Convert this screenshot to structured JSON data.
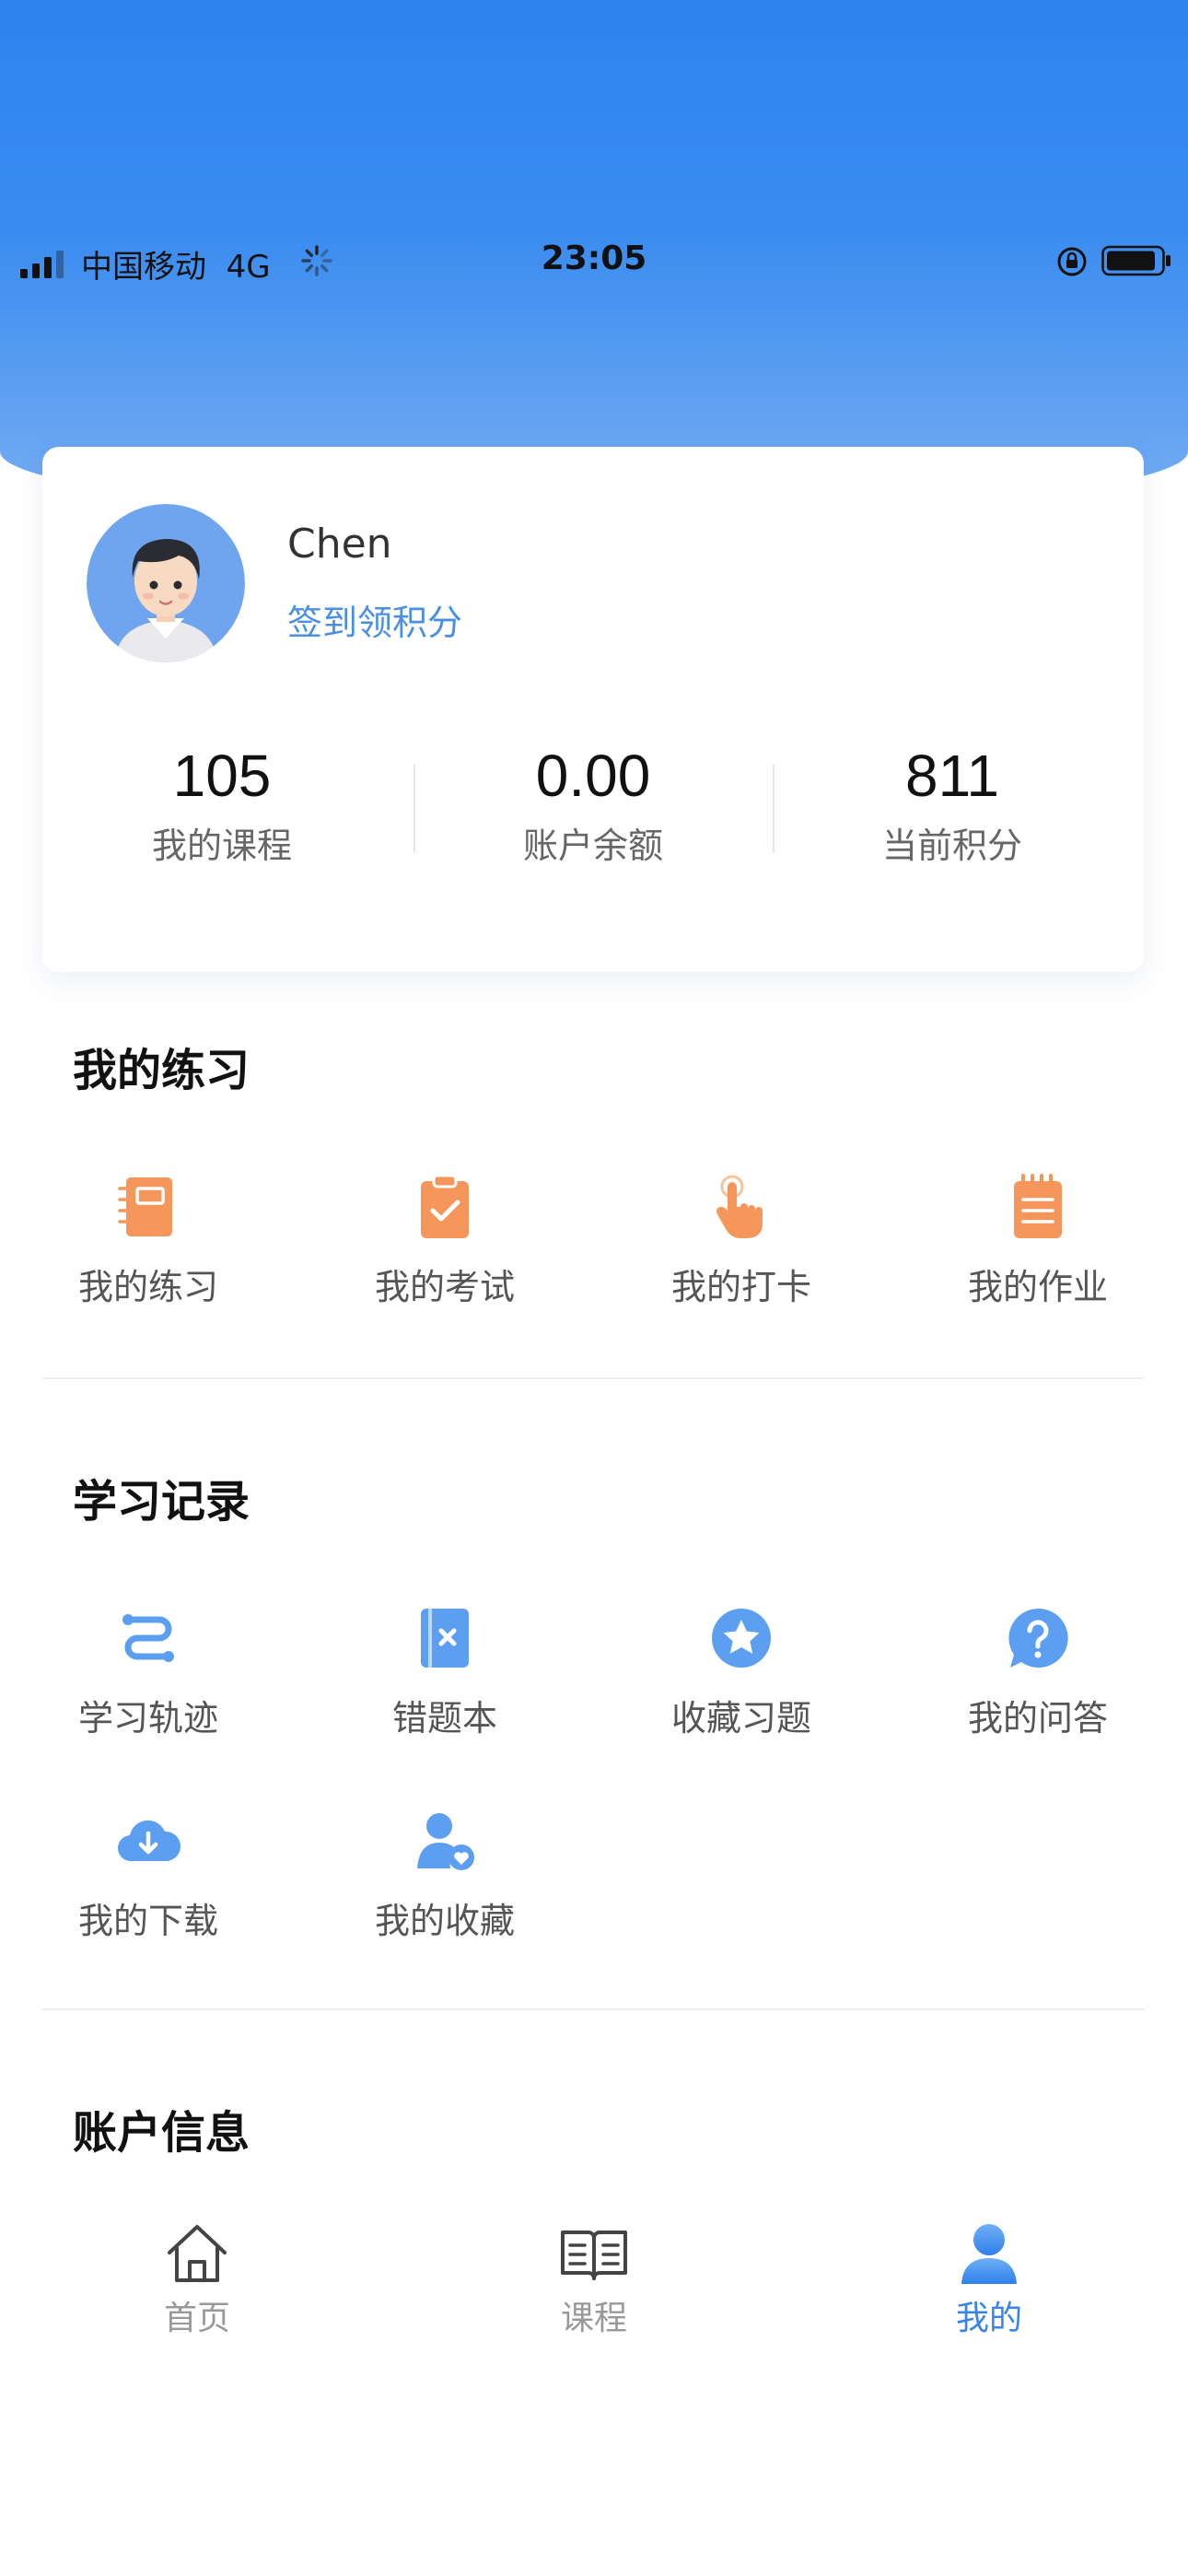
{
  "status_bar": {
    "carrier": "中国移动",
    "network": "4G",
    "time": "23:05"
  },
  "profile": {
    "name": "Chen",
    "checkin_label": "签到领积分",
    "stats": [
      {
        "value": "105",
        "label": "我的课程"
      },
      {
        "value": "0.00",
        "label": "账户余额"
      },
      {
        "value": "811",
        "label": "当前积分"
      }
    ]
  },
  "practice": {
    "title": "我的练习",
    "items": [
      {
        "label": "我的练习",
        "icon": "notebook-icon"
      },
      {
        "label": "我的考试",
        "icon": "clipboard-check-icon"
      },
      {
        "label": "我的打卡",
        "icon": "hand-tap-icon"
      },
      {
        "label": "我的作业",
        "icon": "notepad-icon"
      }
    ]
  },
  "records": {
    "title": "学习记录",
    "items": [
      {
        "label": "学习轨迹",
        "icon": "route-icon"
      },
      {
        "label": "错题本",
        "icon": "wrong-book-icon"
      },
      {
        "label": "收藏习题",
        "icon": "star-circle-icon"
      },
      {
        "label": "我的问答",
        "icon": "question-bubble-icon"
      },
      {
        "label": "我的下载",
        "icon": "cloud-download-icon"
      },
      {
        "label": "我的收藏",
        "icon": "user-heart-icon"
      }
    ]
  },
  "account": {
    "title": "账户信息"
  },
  "tabbar": {
    "items": [
      {
        "label": "首页",
        "icon": "home-icon"
      },
      {
        "label": "课程",
        "icon": "book-icon"
      },
      {
        "label": "我的",
        "icon": "person-icon"
      }
    ],
    "active": "我的"
  },
  "colors": {
    "brand_blue": "#3a84e6",
    "orange_icon": "#f5975a",
    "blue_icon": "#5c9ff0",
    "header_top": "#2f83ef"
  }
}
